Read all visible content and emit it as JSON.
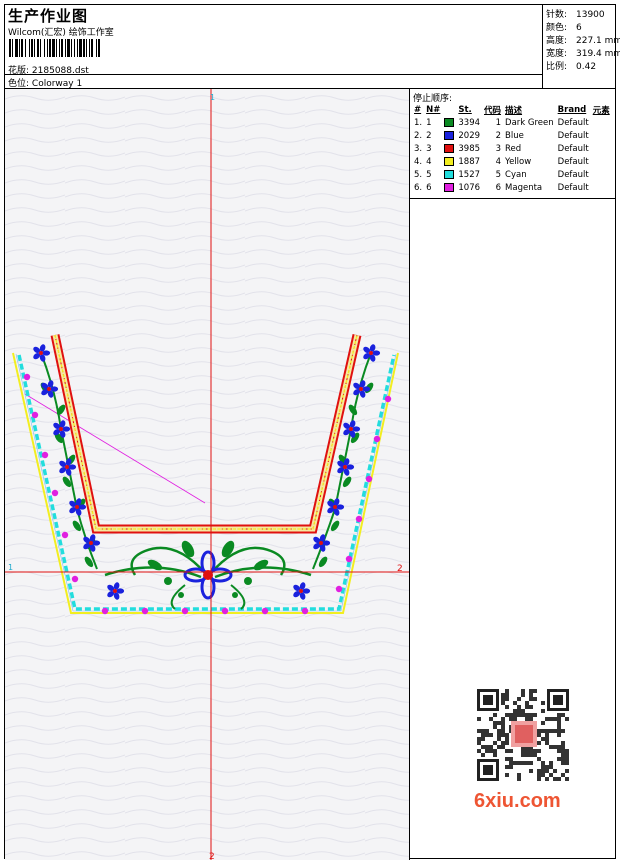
{
  "header": {
    "title": "生产作业图",
    "subtitle": "Wilcom(汇宏) 绘饰工作室",
    "design_label": "花版:",
    "design_value": "2185088.dst",
    "colorway_label": "色位:",
    "colorway_value": "Colorway 1"
  },
  "stats": [
    {
      "label": "针数:",
      "value": "13900"
    },
    {
      "label": "颜色:",
      "value": "6"
    },
    {
      "label": "高度:",
      "value": "227.1 mm"
    },
    {
      "label": "宽度:",
      "value": "319.4 mm"
    },
    {
      "label": "比例:",
      "value": "0.42"
    }
  ],
  "stop_sequence": {
    "title": "停止顺序:",
    "columns": [
      "#",
      "N#",
      "St.",
      "代码",
      "描述",
      "Brand",
      "元素"
    ],
    "rows": [
      {
        "num": "1.",
        "n": "1",
        "color": "#0a8a22",
        "st": "3394",
        "code": "1",
        "desc": "Dark Green",
        "brand": "Default",
        "elem": ""
      },
      {
        "num": "2.",
        "n": "2",
        "color": "#1a22dd",
        "st": "2029",
        "code": "2",
        "desc": "Blue",
        "brand": "Default",
        "elem": ""
      },
      {
        "num": "3.",
        "n": "3",
        "color": "#e01010",
        "st": "3985",
        "code": "3",
        "desc": "Red",
        "brand": "Default",
        "elem": ""
      },
      {
        "num": "4.",
        "n": "4",
        "color": "#f2ee20",
        "st": "1887",
        "code": "4",
        "desc": "Yellow",
        "brand": "Default",
        "elem": ""
      },
      {
        "num": "5.",
        "n": "5",
        "color": "#22dddd",
        "st": "1527",
        "code": "5",
        "desc": "Cyan",
        "brand": "Default",
        "elem": ""
      },
      {
        "num": "6.",
        "n": "6",
        "color": "#e020e0",
        "st": "1076",
        "code": "6",
        "desc": "Magenta",
        "brand": "Default",
        "elem": ""
      }
    ]
  },
  "axis_labels": {
    "top": "1",
    "bottom": "2",
    "left": "1",
    "right": "2"
  },
  "watermark": {
    "text": "6xiu.com"
  }
}
